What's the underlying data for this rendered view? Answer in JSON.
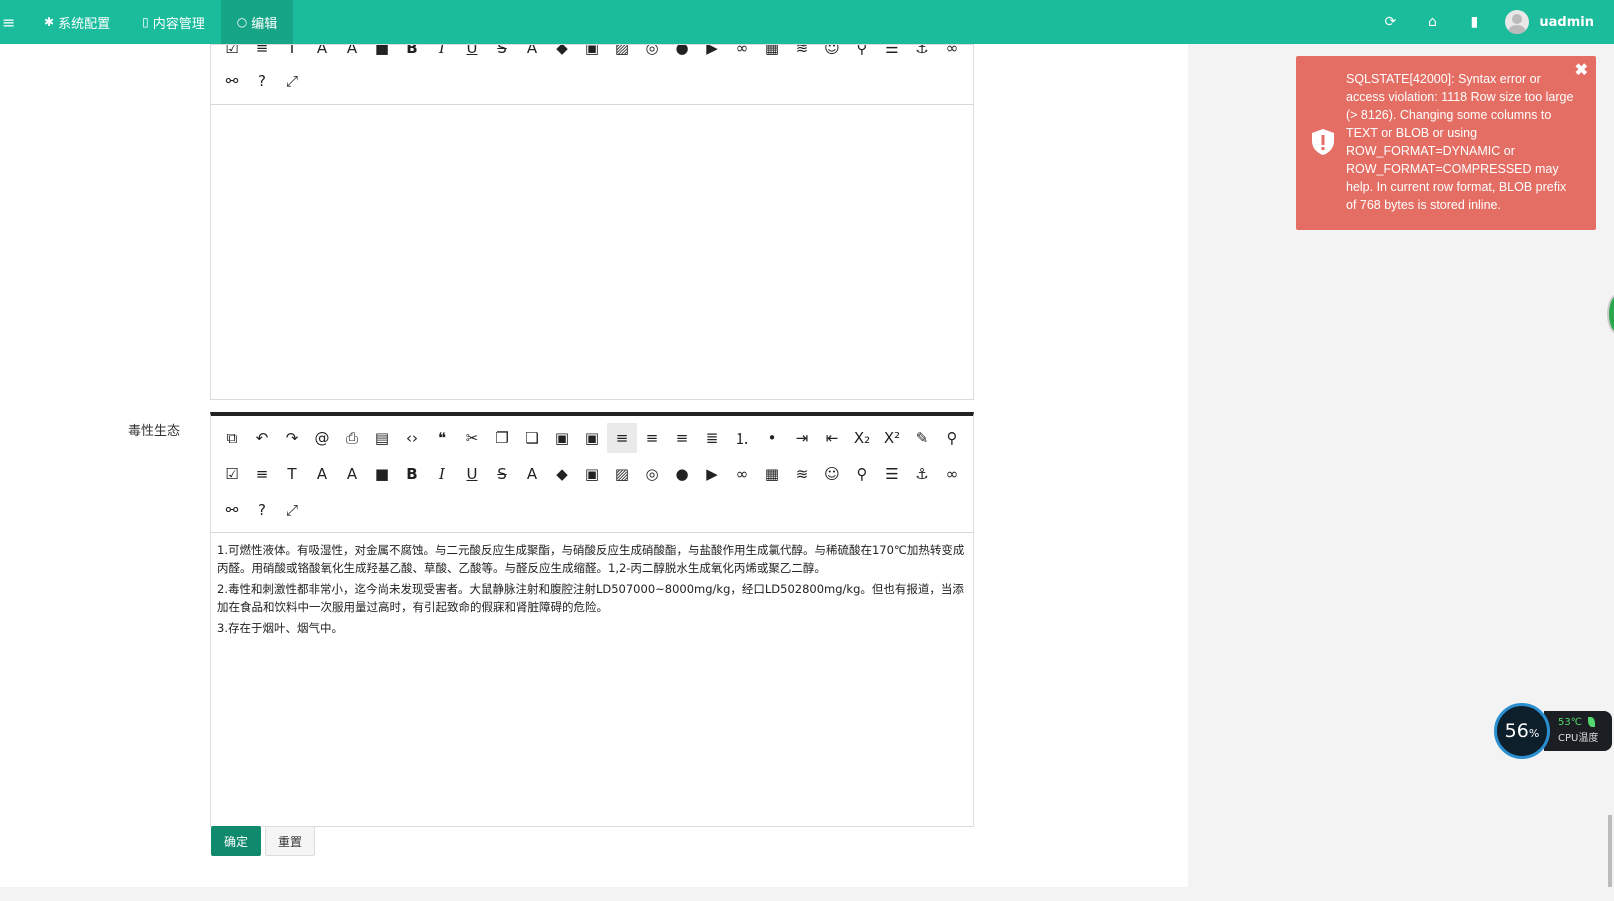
{
  "topbar": {
    "menu_icon": "hamburger-menu-icon",
    "tabs": [
      {
        "icon": "gear-icon",
        "label": "系统配置"
      },
      {
        "icon": "document-icon",
        "label": "内容管理"
      },
      {
        "icon": "circle-icon",
        "label": "编辑"
      }
    ],
    "right_icons": [
      "refresh-icon",
      "home-icon",
      "trash-icon"
    ],
    "username": "uadmin"
  },
  "editor_top": {
    "row_a": [
      "checkbox-icon",
      "title-icon",
      "font-family-icon",
      "font-size-icon",
      "font-color-icon",
      "bg-color-icon",
      "B",
      "I",
      "U",
      "S",
      "A",
      "eraser-icon",
      "image-icon",
      "picture-icon",
      "scrawl-icon",
      "compass-icon",
      "video-icon",
      "link-icon",
      "table-icon",
      "hr-icon",
      "emoji-icon",
      "map-icon",
      "pagebreak-icon",
      "anchor-icon",
      "chain-icon"
    ],
    "row_b": [
      "unlink-icon",
      "help-icon",
      "fullscreen-icon"
    ]
  },
  "field": {
    "label": "毒性生态",
    "content": [
      "1.可燃性液体。有吸湿性，对金属不腐蚀。与二元酸反应生成聚酯，与硝酸反应生成硝酸酯，与盐酸作用生成氯代醇。与稀硫酸在170℃加热转变成丙醛。用硝酸或铬酸氧化生成羟基乙酸、草酸、乙酸等。与醛反应生成缩醛。1,2-丙二醇脱水生成氧化丙烯或聚乙二醇。",
      "2.毒性和刺激性都非常小，迄今尚未发现受害者。大鼠静脉注射和腹腔注射LD507000~8000mg/kg，经口LD502800mg/kg。但也有报道，当添加在食品和饮料中一次服用量过高时，有引起致命的假寐和肾脏障碍的危险。",
      "3.存在于烟叶、烟气中。"
    ]
  },
  "editor_bottom": {
    "row_1": [
      "source-icon",
      "undo-icon",
      "redo-icon",
      "search-replace-icon",
      "print-icon",
      "word-icon",
      "code-icon",
      "blockquote-icon",
      "cut-icon",
      "copy-icon",
      "copy2-icon",
      "paste-icon",
      "paste-text-icon",
      "align-left-icon",
      "align-center-icon",
      "align-right-icon",
      "justify-icon",
      "ordered-list-icon",
      "unordered-list-icon",
      "indent-icon",
      "outdent-icon",
      "X₂",
      "X²",
      "format-icon",
      "preview-icon"
    ],
    "row_2": [
      "checkbox-icon",
      "title-icon",
      "font-family-icon",
      "font-size-icon",
      "font-color-icon",
      "bg-color-icon",
      "B",
      "I",
      "U",
      "S",
      "A",
      "eraser-icon",
      "image-icon",
      "picture-icon",
      "scrawl-icon",
      "compass-icon",
      "video-icon",
      "link-icon",
      "table-icon",
      "hr-icon",
      "emoji-icon",
      "map-icon",
      "pagebreak-icon",
      "anchor-icon",
      "chain-icon"
    ],
    "row_3": [
      "unlink-icon",
      "help-icon",
      "fullscreen-icon"
    ],
    "active_button": "align-left-icon"
  },
  "buttons": {
    "submit": "确定",
    "reset": "重置"
  },
  "alert": {
    "icon": "shield-alert-icon",
    "message": "SQLSTATE[42000]: Syntax error or access violation: 1118 Row size too large (> 8126). Changing some columns to TEXT or BLOB or using ROW_FORMAT=DYNAMIC or ROW_FORMAT=COMPRESSED may help. In current row format, BLOB prefix of 768 bytes is stored inline.",
    "close_icon": "close-icon",
    "color": "#e46e64"
  },
  "cpu_widget": {
    "percent": "56",
    "percent_unit": "%",
    "temp": "53℃",
    "label": "CPU温度"
  },
  "colors": {
    "brand": "#1abc9c",
    "primary_button": "#0f8a6d"
  }
}
